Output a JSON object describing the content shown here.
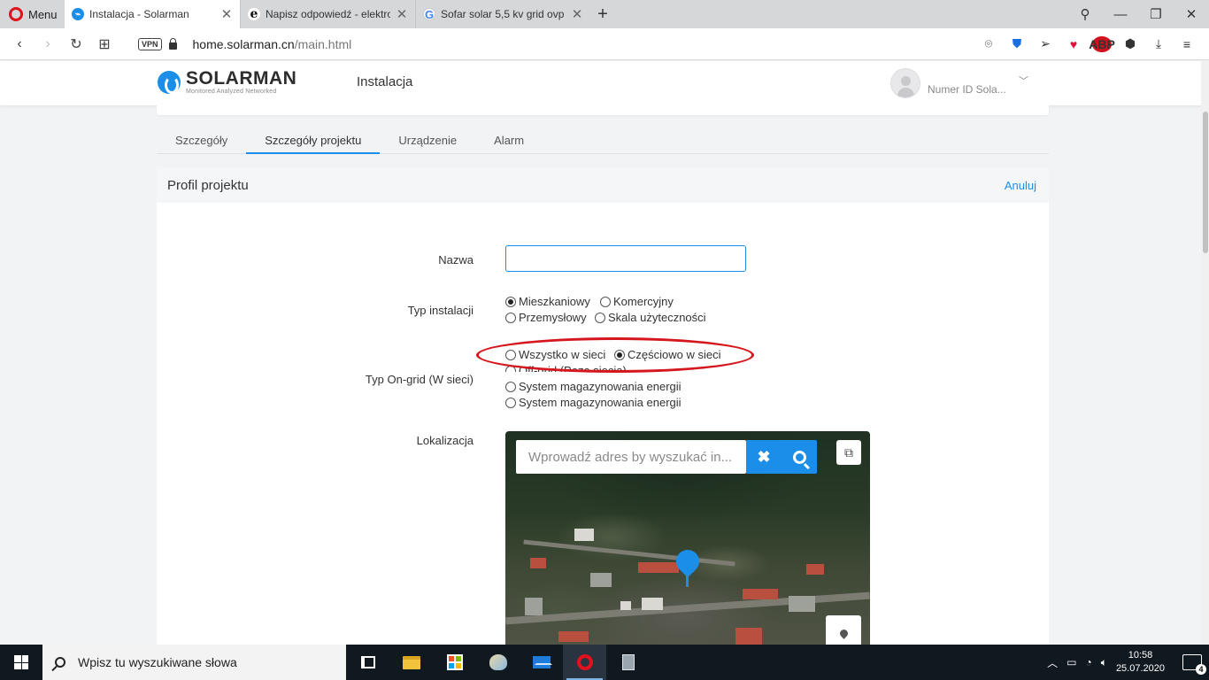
{
  "browser": {
    "menu_label": "Menu",
    "tabs": [
      {
        "title": "Instalacja - Solarman",
        "icon": "solarman-favicon",
        "active": true
      },
      {
        "title": "Napisz odpowiedź - elektro",
        "icon": "edge-e-favicon",
        "active": false
      },
      {
        "title": "Sofar solar 5,5 kv grid ovp",
        "icon": "google-favicon",
        "active": false
      }
    ],
    "url_host": "home.solarman.cn",
    "url_path": "/main.html",
    "vpn_label": "VPN",
    "abp_label": "ABP"
  },
  "header": {
    "logo_word": "SOLARMAN",
    "logo_tagline": "Monitored Analyzed Networked",
    "title": "Instalacja",
    "user_label": "Numer ID Sola..."
  },
  "page_tabs": [
    {
      "label": "Szczegóły",
      "active": false
    },
    {
      "label": "Szczegóły projektu",
      "active": true
    },
    {
      "label": "Urządzenie",
      "active": false
    },
    {
      "label": "Alarm",
      "active": false
    }
  ],
  "panel": {
    "title": "Profil projektu",
    "cancel_label": "Anuluj"
  },
  "form": {
    "name_label": "Nazwa",
    "name_value": "",
    "install_type_label": "Typ instalacji",
    "install_types": [
      {
        "label": "Mieszkaniowy",
        "checked": true
      },
      {
        "label": "Komercyjny",
        "checked": false
      },
      {
        "label": "Przemysłowy",
        "checked": false
      },
      {
        "label": "Skala użyteczności",
        "checked": false
      }
    ],
    "grid_type_label": "Typ On-grid (W sieci)",
    "grid_types": [
      {
        "label": "Wszystko w sieci",
        "checked": false
      },
      {
        "label": "Częściowo w sieci",
        "checked": true
      },
      {
        "label": "Off-grid (Poza siecią)",
        "checked": false
      },
      {
        "label": "System magazynowania energii",
        "checked": false
      },
      {
        "label": "System magazynowania energii",
        "checked": false
      }
    ],
    "location_label": "Lokalizacja",
    "map_search_placeholder": "Wprowadź adres by wyszukać in..."
  },
  "taskbar": {
    "search_placeholder": "Wpisz tu wyszukiwane słowa",
    "time": "10:58",
    "date": "25.07.2020",
    "notifications": "4"
  },
  "colors": {
    "accent": "#1a8ee8",
    "annotation": "#d5161d"
  }
}
